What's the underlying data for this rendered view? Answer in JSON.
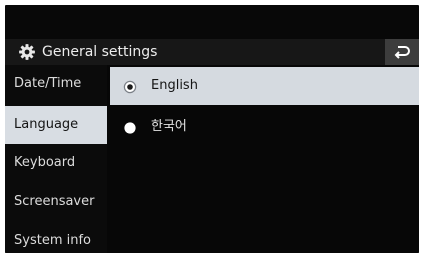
{
  "header": {
    "title": "General settings",
    "title_icon": "gear-icon",
    "back_icon": "back-arrow-icon"
  },
  "sidebar": {
    "items": [
      {
        "label": "Date/Time",
        "selected": false
      },
      {
        "label": "Language",
        "selected": true
      },
      {
        "label": "Keyboard",
        "selected": false
      },
      {
        "label": "Screensaver",
        "selected": false
      },
      {
        "label": "System info",
        "selected": false
      }
    ]
  },
  "language_options": [
    {
      "label": "English",
      "selected": true
    },
    {
      "label": "한국어",
      "selected": false
    }
  ],
  "colors": {
    "background": "#080808",
    "title_bar": "#171717",
    "back_button": "#3d3d3d",
    "selected_row": "#d8dde3",
    "text_light": "#e4e4e4",
    "text_dark": "#151515"
  }
}
